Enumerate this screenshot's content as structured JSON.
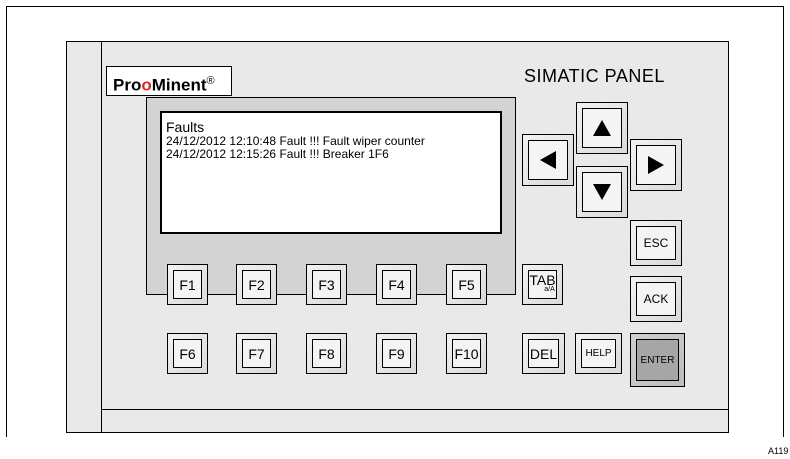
{
  "brand": {
    "pro": "Pro",
    "o": "o",
    "minent": "Minent",
    "reg": "®"
  },
  "panel_title": "SIMATIC PANEL",
  "display": {
    "title": "Faults",
    "lines": [
      "24/12/2012 12:10:48 Fault !!! Fault wiper counter",
      "24/12/2012 12:15:26 Fault !!! Breaker 1F6"
    ]
  },
  "function_keys": {
    "row1": [
      "F1",
      "F2",
      "F3",
      "F4",
      "F5"
    ],
    "row2": [
      "F6",
      "F7",
      "F8",
      "F9",
      "F10"
    ]
  },
  "keys": {
    "tab": "TAB",
    "tab_sub": "a/A",
    "del": "DEL",
    "help": "HELP",
    "esc": "ESC",
    "ack": "ACK",
    "enter": "ENTER"
  },
  "arrows": [
    "arrow-up-icon",
    "arrow-left-icon",
    "arrow-right-icon",
    "arrow-down-icon"
  ],
  "figure_label": "A119",
  "colors": {
    "brand_o": "#e1261c",
    "enter_key": "#a6a6a6",
    "panel": "#e9e9e9"
  }
}
